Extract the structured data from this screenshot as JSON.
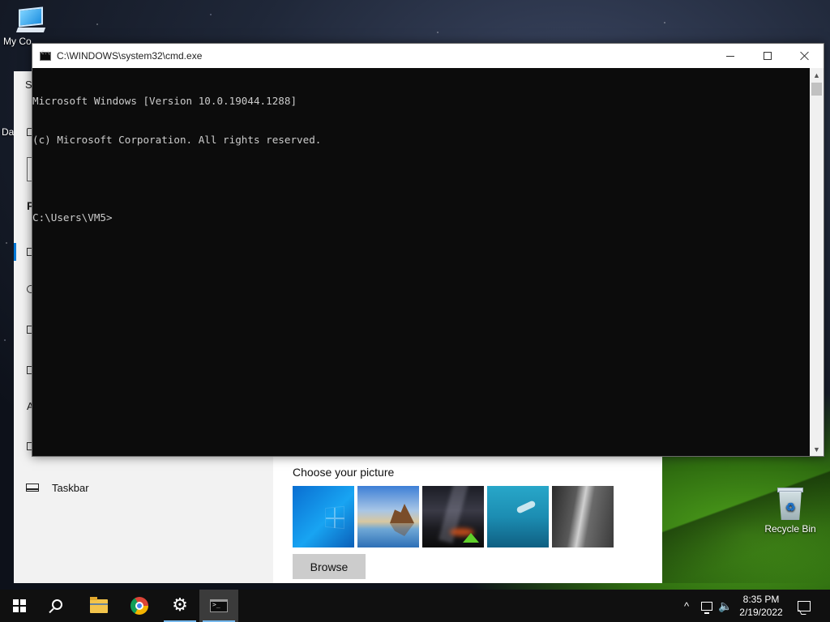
{
  "desktop": {
    "icons": [
      {
        "label": "My Co",
        "icon": "computer-icon"
      },
      {
        "label": "Recycle Bin",
        "icon": "recycle-bin-icon"
      }
    ],
    "partial_label": "Da"
  },
  "settings_window": {
    "nav_fragments": [
      "S",
      "P",
      "A"
    ],
    "taskbar_item_label": "Taskbar",
    "choose_picture_label": "Choose your picture",
    "thumbnails": [
      "windows-blue-wallpaper",
      "beach-rock-wallpaper",
      "night-tent-wallpaper",
      "underwater-swimmer-wallpaper",
      "rock-cliff-wallpaper"
    ],
    "browse_label": "Browse"
  },
  "cmd_window": {
    "title": "C:\\WINDOWS\\system32\\cmd.exe",
    "lines": [
      "Microsoft Windows [Version 10.0.19044.1288]",
      "(c) Microsoft Corporation. All rights reserved.",
      "",
      "C:\\Users\\VM5>"
    ]
  },
  "taskbar": {
    "pinned": [
      "start-icon",
      "search-icon",
      "file-explorer-icon",
      "chrome-icon",
      "settings-gear-icon",
      "command-prompt-icon"
    ],
    "active_app": "command-prompt",
    "tray": {
      "chevron": "^",
      "time": "8:35 PM",
      "date": "2/19/2022"
    }
  },
  "colors": {
    "accent": "#0078d7",
    "console_bg": "#0c0c0c",
    "console_fg": "#cccccc",
    "taskbar_bg": "#101010"
  }
}
